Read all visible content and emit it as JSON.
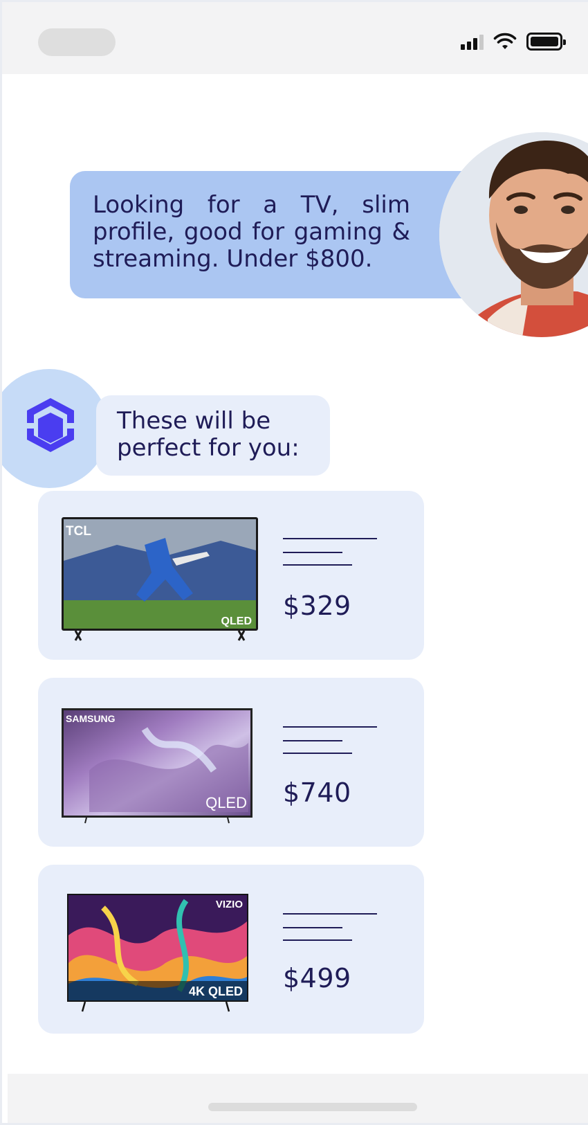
{
  "chat": {
    "user_message": "Looking for a TV, slim profile, good for gaming & streaming. Under $800.",
    "bot_message": "These will be perfect for you:"
  },
  "products": [
    {
      "brand": "TCL",
      "badge": "QLED",
      "price": "$329"
    },
    {
      "brand": "SAMSUNG",
      "badge": "QLED",
      "price": "$740"
    },
    {
      "brand": "VIZIO",
      "badge": "4K QLED",
      "price": "$499"
    }
  ],
  "colors": {
    "user_bubble": "#abc6f2",
    "bot_bubble": "#e8eefa",
    "accent": "#4a3df0",
    "text": "#1f1c57"
  }
}
